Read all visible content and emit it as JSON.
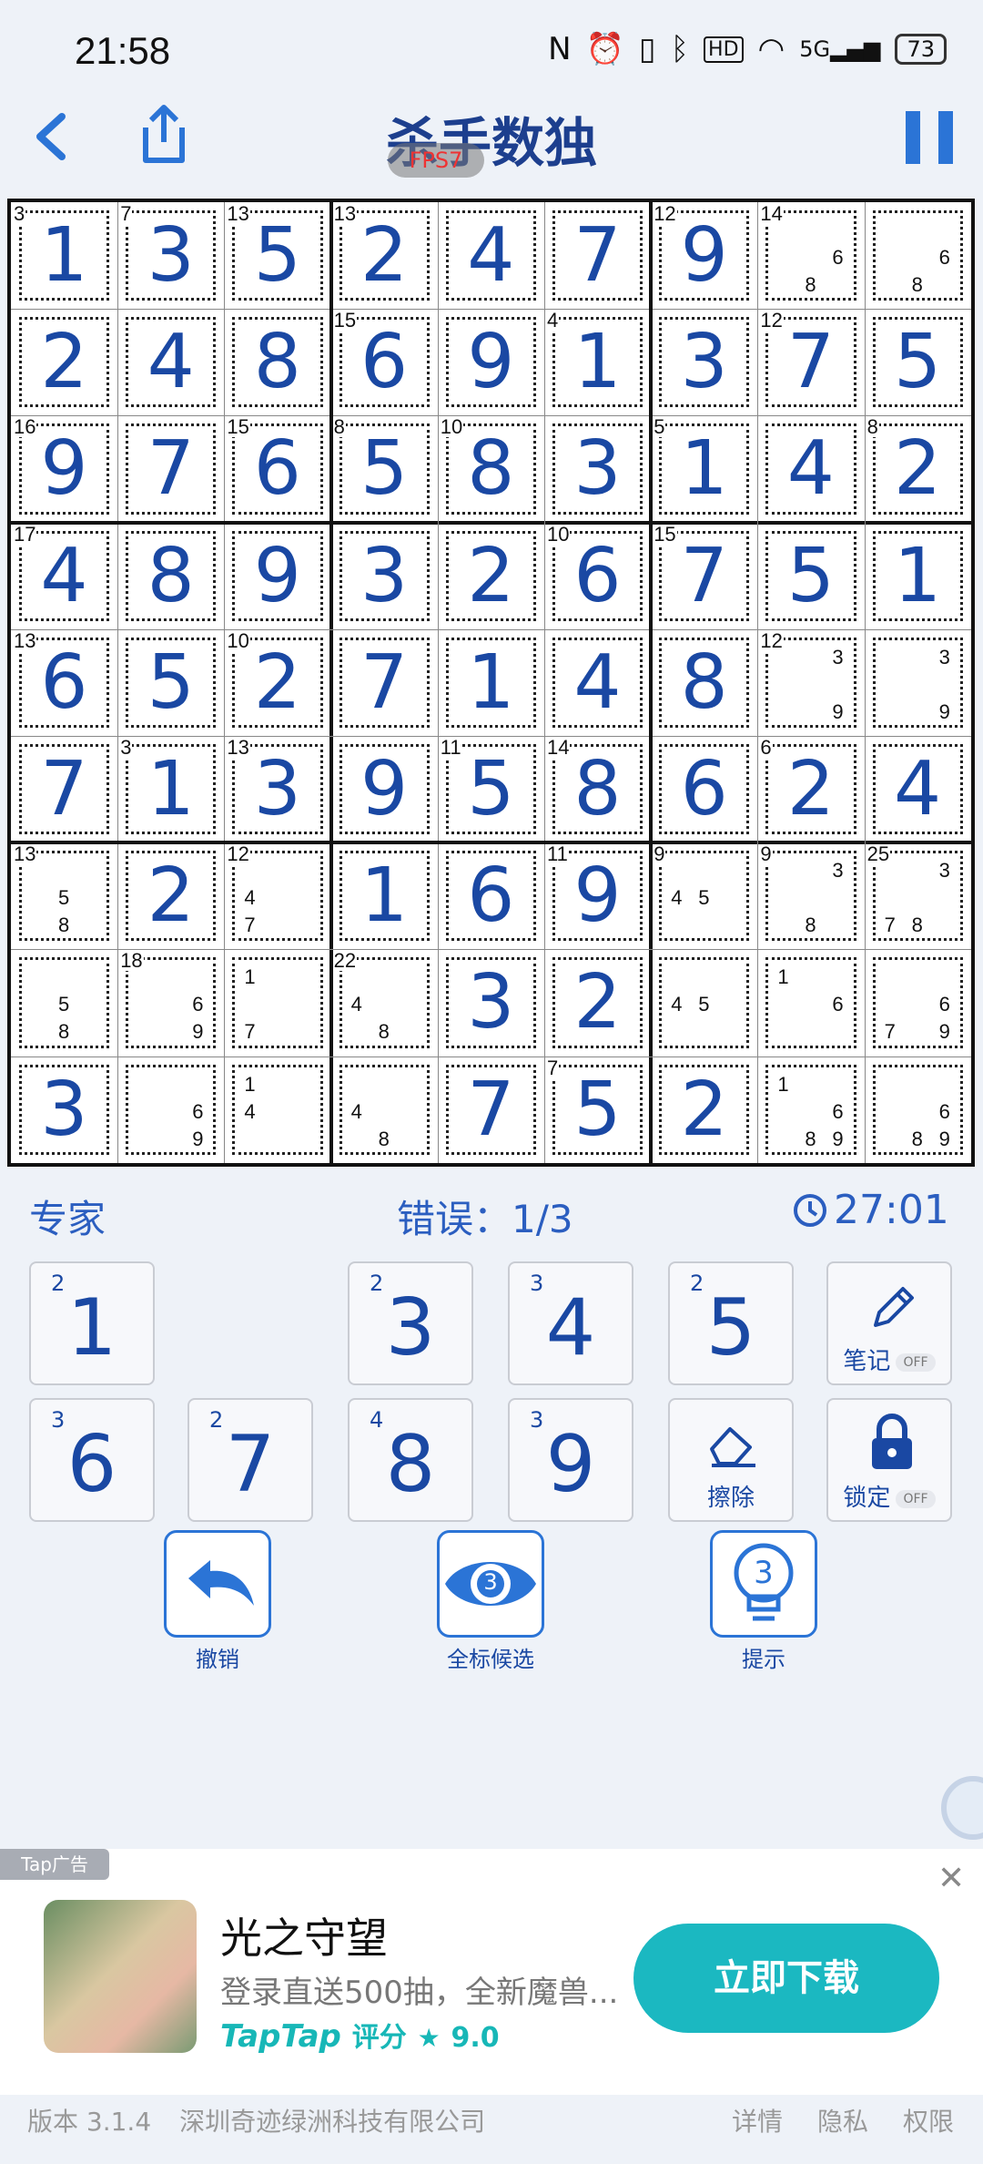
{
  "status_bar": {
    "time": "21:58",
    "battery": "73",
    "network": "5G"
  },
  "header": {
    "title": "杀手数独",
    "fps_badge": "FPS7"
  },
  "board": {
    "grid": [
      [
        1,
        3,
        5,
        2,
        4,
        7,
        9,
        0,
        0
      ],
      [
        2,
        4,
        8,
        6,
        9,
        1,
        3,
        7,
        5
      ],
      [
        9,
        7,
        6,
        5,
        8,
        3,
        1,
        4,
        2
      ],
      [
        4,
        8,
        9,
        3,
        2,
        6,
        7,
        5,
        1
      ],
      [
        6,
        5,
        2,
        7,
        1,
        4,
        8,
        0,
        0
      ],
      [
        7,
        1,
        3,
        9,
        5,
        8,
        6,
        2,
        4
      ],
      [
        0,
        2,
        0,
        1,
        6,
        9,
        0,
        0,
        0
      ],
      [
        0,
        0,
        0,
        0,
        3,
        2,
        0,
        0,
        0
      ],
      [
        3,
        0,
        0,
        0,
        7,
        5,
        2,
        0,
        0
      ]
    ],
    "cage_sums": [
      {
        "r": 0,
        "c": 0,
        "s": "3"
      },
      {
        "r": 0,
        "c": 1,
        "s": "7"
      },
      {
        "r": 0,
        "c": 2,
        "s": "13"
      },
      {
        "r": 0,
        "c": 3,
        "s": "13"
      },
      {
        "r": 0,
        "c": 6,
        "s": "12"
      },
      {
        "r": 0,
        "c": 7,
        "s": "14"
      },
      {
        "r": 1,
        "c": 3,
        "s": "15"
      },
      {
        "r": 1,
        "c": 5,
        "s": "4"
      },
      {
        "r": 1,
        "c": 7,
        "s": "12"
      },
      {
        "r": 2,
        "c": 0,
        "s": "16"
      },
      {
        "r": 2,
        "c": 2,
        "s": "15"
      },
      {
        "r": 2,
        "c": 3,
        "s": "8"
      },
      {
        "r": 2,
        "c": 4,
        "s": "10"
      },
      {
        "r": 2,
        "c": 6,
        "s": "5"
      },
      {
        "r": 2,
        "c": 8,
        "s": "8"
      },
      {
        "r": 3,
        "c": 0,
        "s": "17"
      },
      {
        "r": 3,
        "c": 5,
        "s": "10"
      },
      {
        "r": 3,
        "c": 6,
        "s": "15"
      },
      {
        "r": 4,
        "c": 0,
        "s": "13"
      },
      {
        "r": 4,
        "c": 2,
        "s": "10"
      },
      {
        "r": 4,
        "c": 7,
        "s": "12"
      },
      {
        "r": 5,
        "c": 1,
        "s": "3"
      },
      {
        "r": 5,
        "c": 2,
        "s": "13"
      },
      {
        "r": 5,
        "c": 4,
        "s": "11"
      },
      {
        "r": 5,
        "c": 5,
        "s": "14"
      },
      {
        "r": 5,
        "c": 7,
        "s": "6"
      },
      {
        "r": 6,
        "c": 0,
        "s": "13"
      },
      {
        "r": 6,
        "c": 2,
        "s": "12"
      },
      {
        "r": 6,
        "c": 5,
        "s": "11"
      },
      {
        "r": 6,
        "c": 6,
        "s": "9"
      },
      {
        "r": 6,
        "c": 7,
        "s": "9"
      },
      {
        "r": 6,
        "c": 8,
        "s": "25"
      },
      {
        "r": 7,
        "c": 1,
        "s": "18"
      },
      {
        "r": 7,
        "c": 3,
        "s": "22"
      },
      {
        "r": 8,
        "c": 5,
        "s": "7"
      }
    ],
    "notes": [
      {
        "r": 0,
        "c": 7,
        "d": [
          6,
          8
        ]
      },
      {
        "r": 0,
        "c": 8,
        "d": [
          6,
          8
        ]
      },
      {
        "r": 4,
        "c": 7,
        "d": [
          3,
          9
        ]
      },
      {
        "r": 4,
        "c": 8,
        "d": [
          3,
          9
        ]
      },
      {
        "r": 6,
        "c": 0,
        "d": [
          5,
          8
        ]
      },
      {
        "r": 6,
        "c": 2,
        "d": [
          4,
          7
        ]
      },
      {
        "r": 6,
        "c": 6,
        "d": [
          4,
          5
        ]
      },
      {
        "r": 6,
        "c": 7,
        "d": [
          3,
          8
        ]
      },
      {
        "r": 6,
        "c": 8,
        "d": [
          3,
          7,
          8
        ]
      },
      {
        "r": 7,
        "c": 0,
        "d": [
          5,
          8
        ]
      },
      {
        "r": 7,
        "c": 1,
        "d": [
          6,
          9
        ]
      },
      {
        "r": 7,
        "c": 2,
        "d": [
          1,
          7
        ]
      },
      {
        "r": 7,
        "c": 3,
        "d": [
          4,
          8
        ]
      },
      {
        "r": 7,
        "c": 6,
        "d": [
          4,
          5
        ]
      },
      {
        "r": 7,
        "c": 7,
        "d": [
          1,
          6
        ]
      },
      {
        "r": 7,
        "c": 8,
        "d": [
          6,
          7,
          9
        ]
      },
      {
        "r": 8,
        "c": 1,
        "d": [
          6,
          9
        ]
      },
      {
        "r": 8,
        "c": 2,
        "d": [
          1,
          4
        ]
      },
      {
        "r": 8,
        "c": 3,
        "d": [
          4,
          8
        ]
      },
      {
        "r": 8,
        "c": 7,
        "d": [
          1,
          6,
          8,
          9
        ]
      },
      {
        "r": 8,
        "c": 8,
        "d": [
          6,
          8,
          9
        ]
      }
    ]
  },
  "info": {
    "difficulty": "专家",
    "errors": "错误：1/3",
    "timer": "27:01"
  },
  "keypad": {
    "numbers": [
      {
        "label": "1",
        "count": "2"
      },
      {
        "label": "3",
        "count": "2"
      },
      {
        "label": "4",
        "count": "3"
      },
      {
        "label": "5",
        "count": "2"
      },
      {
        "label": "6",
        "count": "3"
      },
      {
        "label": "7",
        "count": "2"
      },
      {
        "label": "8",
        "count": "4"
      },
      {
        "label": "9",
        "count": "3"
      }
    ],
    "notes_label": "笔记",
    "notes_state": "OFF",
    "erase_label": "擦除",
    "lock_label": "锁定",
    "lock_state": "OFF"
  },
  "actions": {
    "undo_label": "撤销",
    "candidates_label": "全标候选",
    "candidates_count": "3",
    "hint_label": "提示",
    "hint_count": "3"
  },
  "ad": {
    "tag": "Tap广告",
    "title": "光之守望",
    "description": "登录直送500抽，全新魔兽...",
    "brand": "TapTap",
    "rating_label": "评分",
    "rating": "9.0",
    "button": "立即下载"
  },
  "footer": {
    "version": "版本 3.1.4",
    "company": "深圳奇迹绿洲科技有限公司",
    "links": [
      "详情",
      "隐私",
      "权限"
    ]
  },
  "colors": {
    "accent": "#2b74d6",
    "digit": "#1a48a3",
    "ad_button": "#1bb8c1"
  }
}
